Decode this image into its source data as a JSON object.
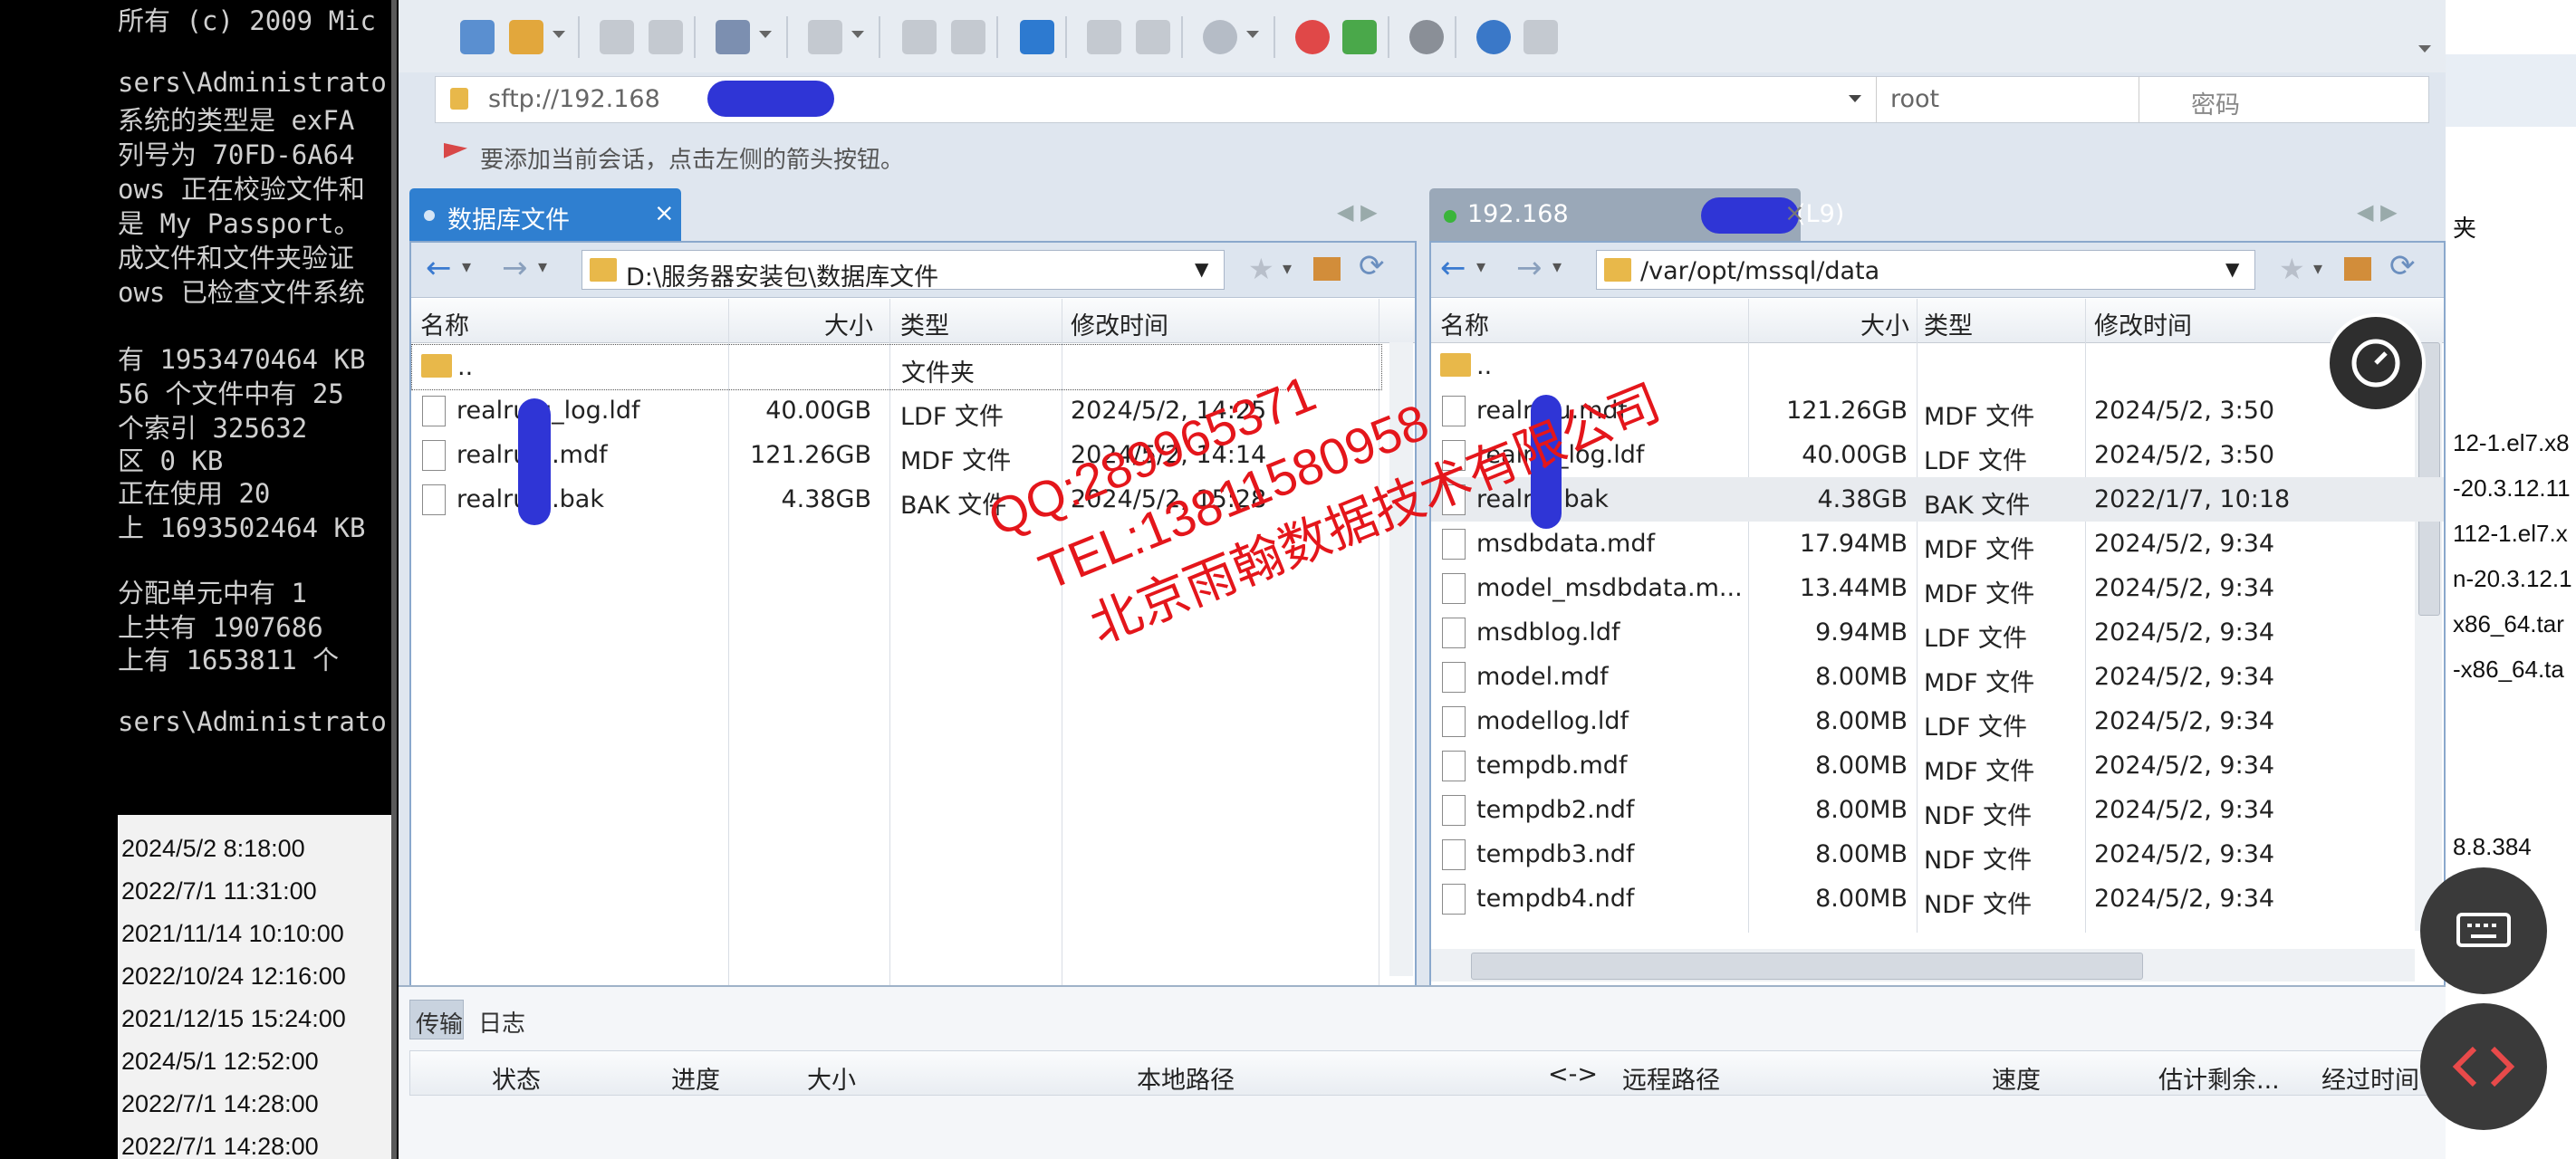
{
  "console": {
    "lines": [
      "所有 (c) 2009 Mic",
      "sers\\Administrato",
      "系统的类型是 exFA",
      "列号为 70FD-6A64",
      "ows 正在校验文件和",
      "是 My Passport。",
      "成文件和文件夹验证",
      "ows 已检查文件系统",
      "有 1953470464 KB",
      "56 个文件中有  25",
      "个索引       325632",
      "区           0 KB",
      "正在使用         20",
      "上 1693502464 KB",
      "分配单元中有      1",
      "上共有    1907686",
      "上有     1653811 个",
      "sers\\Administrato"
    ]
  },
  "datelist": [
    "2024/5/2 8:18:00",
    "2022/7/1 11:31:00",
    "2021/11/14 10:10:00",
    "2022/10/24 12:16:00",
    "2021/12/15 15:24:00",
    "2024/5/1 12:52:00",
    "2022/7/1 14:28:00",
    "2022/7/1 14:28:00"
  ],
  "address": {
    "url": "sftp://192.168",
    "user": "root",
    "password_placeholder": "密码"
  },
  "notice": "要添加当前会话，点击左侧的箭头按钮。",
  "left_panel": {
    "tab_label": "数据库文件",
    "path": "D:\\服务器安装包\\数据库文件",
    "columns": {
      "name": "名称",
      "size": "大小",
      "type": "类型",
      "mtime": "修改时间"
    },
    "parent": {
      "name": "..",
      "type": "文件夹"
    },
    "files": [
      {
        "name": "realru    u_log.ldf",
        "size": "40.00GB",
        "type": "LDF 文件",
        "mtime": "2024/5/2, 14:25"
      },
      {
        "name": "realru    u.mdf",
        "size": "121.26GB",
        "type": "MDF 文件",
        "mtime": "2024/5/2, 14:14"
      },
      {
        "name": "realru    u.bak",
        "size": "4.38GB",
        "type": "BAK 文件",
        "mtime": "2024/5/2, 15:28"
      }
    ]
  },
  "right_panel": {
    "tab_label_prefix": "192.168",
    "tab_label_suffix": "(L9)",
    "path": "/var/opt/mssql/data",
    "columns": {
      "name": "名称",
      "size": "大小",
      "type": "类型",
      "mtime": "修改时间"
    },
    "parent": {
      "name": ".."
    },
    "files": [
      {
        "name": "realr    ou.mdf",
        "size": "121.26GB",
        "type": "MDF 文件",
        "mtime": "2024/5/2, 3:50"
      },
      {
        "name": "realr    u_log.ldf",
        "size": "40.00GB",
        "type": "LDF 文件",
        "mtime": "2024/5/2, 3:50"
      },
      {
        "name": "realr    u.bak",
        "size": "4.38GB",
        "type": "BAK 文件",
        "mtime": "2022/1/7, 10:18"
      },
      {
        "name": "msdbdata.mdf",
        "size": "17.94MB",
        "type": "MDF 文件",
        "mtime": "2024/5/2, 9:34"
      },
      {
        "name": "model_msdbdata.m...",
        "size": "13.44MB",
        "type": "MDF 文件",
        "mtime": "2024/5/2, 9:34"
      },
      {
        "name": "msdblog.ldf",
        "size": "9.94MB",
        "type": "LDF 文件",
        "mtime": "2024/5/2, 9:34"
      },
      {
        "name": "model.mdf",
        "size": "8.00MB",
        "type": "MDF 文件",
        "mtime": "2024/5/2, 9:34"
      },
      {
        "name": "modellog.ldf",
        "size": "8.00MB",
        "type": "LDF 文件",
        "mtime": "2024/5/2, 9:34"
      },
      {
        "name": "tempdb.mdf",
        "size": "8.00MB",
        "type": "MDF 文件",
        "mtime": "2024/5/2, 9:34"
      },
      {
        "name": "tempdb2.ndf",
        "size": "8.00MB",
        "type": "NDF 文件",
        "mtime": "2024/5/2, 9:34"
      },
      {
        "name": "tempdb3.ndf",
        "size": "8.00MB",
        "type": "NDF 文件",
        "mtime": "2024/5/2, 9:34"
      },
      {
        "name": "tempdb4.ndf",
        "size": "8.00MB",
        "type": "NDF 文件",
        "mtime": "2024/5/2, 9:34"
      }
    ]
  },
  "bottom": {
    "tabs": [
      "传输",
      "日志"
    ],
    "columns": [
      "状态",
      "进度",
      "大小",
      "本地路径",
      "<->",
      "远程路径",
      "速度",
      "估计剩余...",
      "经过时间"
    ]
  },
  "right_window": {
    "header": "夹",
    "items": [
      "12-1.el7.x8",
      "-20.3.12.11",
      "112-1.el7.x",
      "n-20.3.12.1",
      "x86_64.tar",
      "-x86_64.ta",
      "8.8.384"
    ]
  },
  "watermark": {
    "line1": "QQ:289965371",
    "line2": "TEL:13811580958",
    "line3": "北京雨翰数据技术有限公司"
  },
  "colors": {
    "watermark": "#e4161b",
    "redaction": "#2f35d6",
    "tab_active": "#2f7fd0"
  },
  "icons": [
    "lock-icon",
    "flag-icon",
    "back-icon",
    "forward-icon",
    "folder-icon",
    "home-icon",
    "refresh-icon",
    "star-icon",
    "keyboard-icon",
    "code-icon",
    "timer-icon"
  ]
}
